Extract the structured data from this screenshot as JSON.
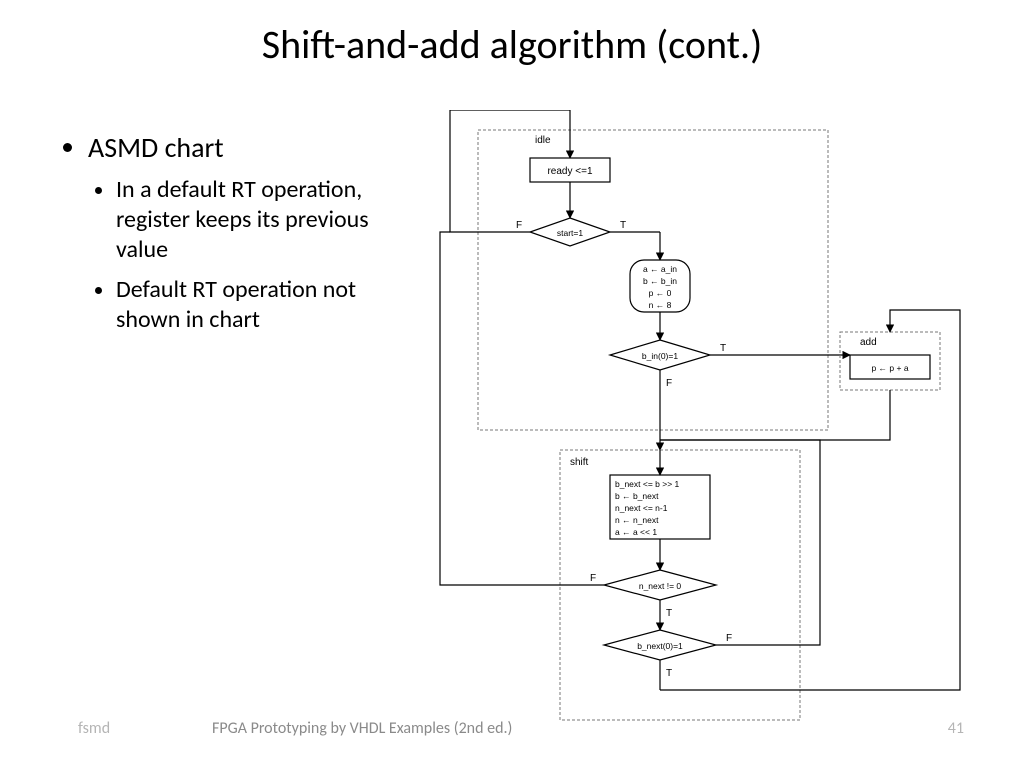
{
  "title": "Shift-and-add algorithm (cont.)",
  "bullets": {
    "main": "ASMD chart",
    "sub1": "In a default RT operation, register keeps its previous value",
    "sub2": "Default RT operation not shown in chart"
  },
  "footer": {
    "left": "fsmd",
    "mid": "FPGA Prototyping by VHDL Examples (2nd ed.)",
    "right": "41"
  },
  "chart": {
    "idle_state": "idle",
    "ready_box": "ready <=1",
    "start_dec": "start=1",
    "init_ops": [
      "a ← a_in",
      "b ← b_in",
      "p ← 0",
      "n ← 8"
    ],
    "bin0_dec": "b_in(0)=1",
    "add_state": "add",
    "add_box": "p ← p + a",
    "shift_state": "shift",
    "shift_ops": [
      "b_next <= b >> 1",
      "b ← b_next",
      "n_next <= n-1",
      "n ← n_next",
      "a ← a << 1"
    ],
    "nnext_dec": "n_next != 0",
    "bnext0_dec": "b_next(0)=1",
    "T": "T",
    "F": "F"
  }
}
